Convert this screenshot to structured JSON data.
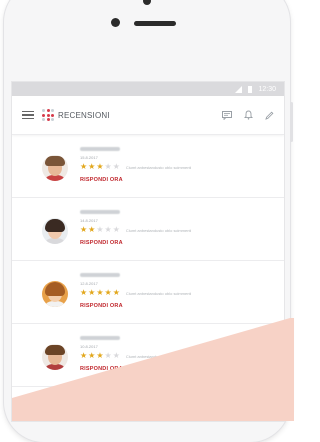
{
  "app": {
    "title": "RECENSIONI"
  },
  "statusbar": {
    "time": "12:30"
  },
  "reviews": [
    {
      "date": "15.8.2017",
      "rating": 3,
      "snippet": "Ciumt anbestandusto oblo scimmenti",
      "reply_label": "RISPONDI ORA"
    },
    {
      "date": "14.8.2017",
      "rating": 2,
      "snippet": "Ciumt anbestandusto oblo scimmenti",
      "reply_label": "RISPONDI ORA"
    },
    {
      "date": "12.8.2017",
      "rating": 5,
      "snippet": "Ciumt anbestandusto oblo scimmenti",
      "reply_label": "RISPONDI ORA"
    },
    {
      "date": "10.8.2017",
      "rating": 3,
      "snippet": "Ciumt anbestandusto oblo scimmenti",
      "reply_label": "RISPONDI ORA"
    }
  ],
  "icons": {
    "menu": "hamburger-icon",
    "chat": "chat-icon",
    "bell": "bell-icon",
    "edit": "pencil-icon"
  },
  "colors": {
    "accent": "#c0272d",
    "star": "#e2a71c",
    "statusbar": "#dadadd",
    "decor": "#f7d2c6"
  }
}
